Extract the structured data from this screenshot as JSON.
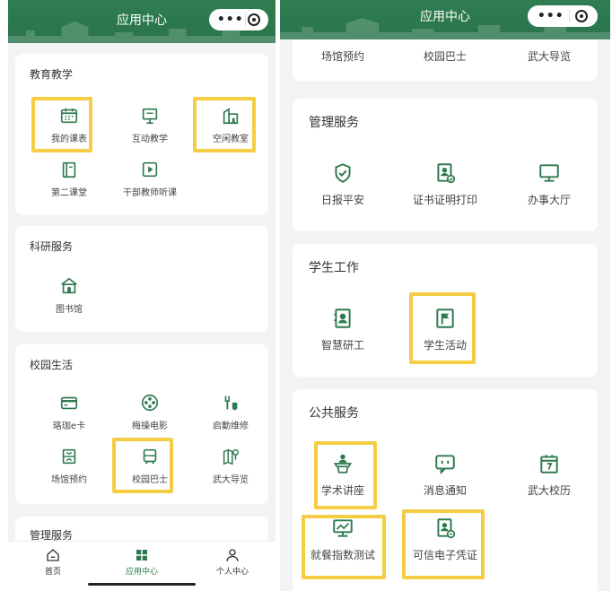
{
  "left": {
    "header_title": "应用中心",
    "sections": [
      {
        "title": "教育教学",
        "items": [
          "我的课表",
          "互动教学",
          "空闲教室",
          "第二课堂",
          "干部教师听课"
        ]
      },
      {
        "title": "科研服务",
        "items": [
          "图书馆"
        ]
      },
      {
        "title": "校园生活",
        "items": [
          "珞珈e卡",
          "梅操电影",
          "启動维修",
          "场馆预约",
          "校园巴士",
          "武大导览"
        ]
      },
      {
        "title": "管理服务",
        "items": []
      }
    ],
    "tabs": [
      "首页",
      "应用中心",
      "个人中心"
    ]
  },
  "right": {
    "header_title": "应用中心",
    "top_row": [
      "场馆预约",
      "校园巴士",
      "武大导览"
    ],
    "sections": [
      {
        "title": "管理服务",
        "items": [
          "日报平安",
          "证书证明打印",
          "办事大厅"
        ]
      },
      {
        "title": "学生工作",
        "items": [
          "智慧研工",
          "学生活动"
        ]
      },
      {
        "title": "公共服务",
        "items": [
          "学术讲座",
          "消息通知",
          "武大校历",
          "就餐指数测试",
          "可信电子凭证"
        ]
      }
    ]
  },
  "colors": {
    "primary": "#2e7a4f",
    "highlight": "#f5cd45",
    "background": "#f2f3f2"
  },
  "icons": {
    "calendar": "calendar-icon",
    "teaching": "presentation-icon",
    "classroom": "building-icon",
    "book": "book-icon",
    "play": "video-play-icon",
    "library": "library-icon",
    "card": "card-icon",
    "film": "film-reel-icon",
    "repair": "wrench-icon",
    "venue": "venue-icon",
    "bus": "bus-icon",
    "guide": "map-pin-icon",
    "shield": "shield-check-icon",
    "certificate": "certificate-print-icon",
    "monitor": "monitor-icon",
    "badge": "id-badge-icon",
    "flag": "flag-icon",
    "lecture": "podium-icon",
    "message": "message-icon",
    "calendar7": "calendar-date-icon",
    "chart": "chart-monitor-icon",
    "voucher": "voucher-icon",
    "home": "home-icon",
    "apps": "grid-icon",
    "user": "user-icon"
  }
}
